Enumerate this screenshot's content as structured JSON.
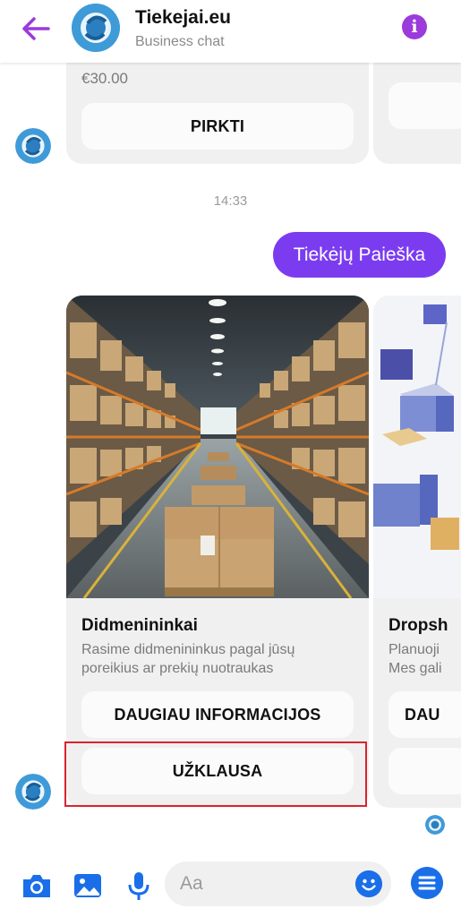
{
  "header": {
    "title": "Tiekejai.eu",
    "subtitle": "Business chat"
  },
  "top_card": {
    "price": "€30.00",
    "buy_label": "PIRKTI"
  },
  "timestamp": "14:33",
  "sent_message": "Tiekėjų Paieška",
  "carousel": [
    {
      "title": "Didmenininkai",
      "desc_line1": "Rasime didmenininkus pagal jūsų",
      "desc_line2": "poreikius ar prekių nuotraukas",
      "more_label": "DAUGIAU INFORMACIJOS",
      "inquiry_label": "UŽKLAUSA"
    },
    {
      "title": "Dropsh",
      "desc_line1": "Planuoji",
      "desc_line2": "Mes gali",
      "more_label": "DAU"
    }
  ],
  "composer": {
    "placeholder": "Aa"
  },
  "colors": {
    "accent": "#7b3cf0",
    "messenger_blue": "#1a6fe8",
    "highlight": "#d9232f"
  }
}
